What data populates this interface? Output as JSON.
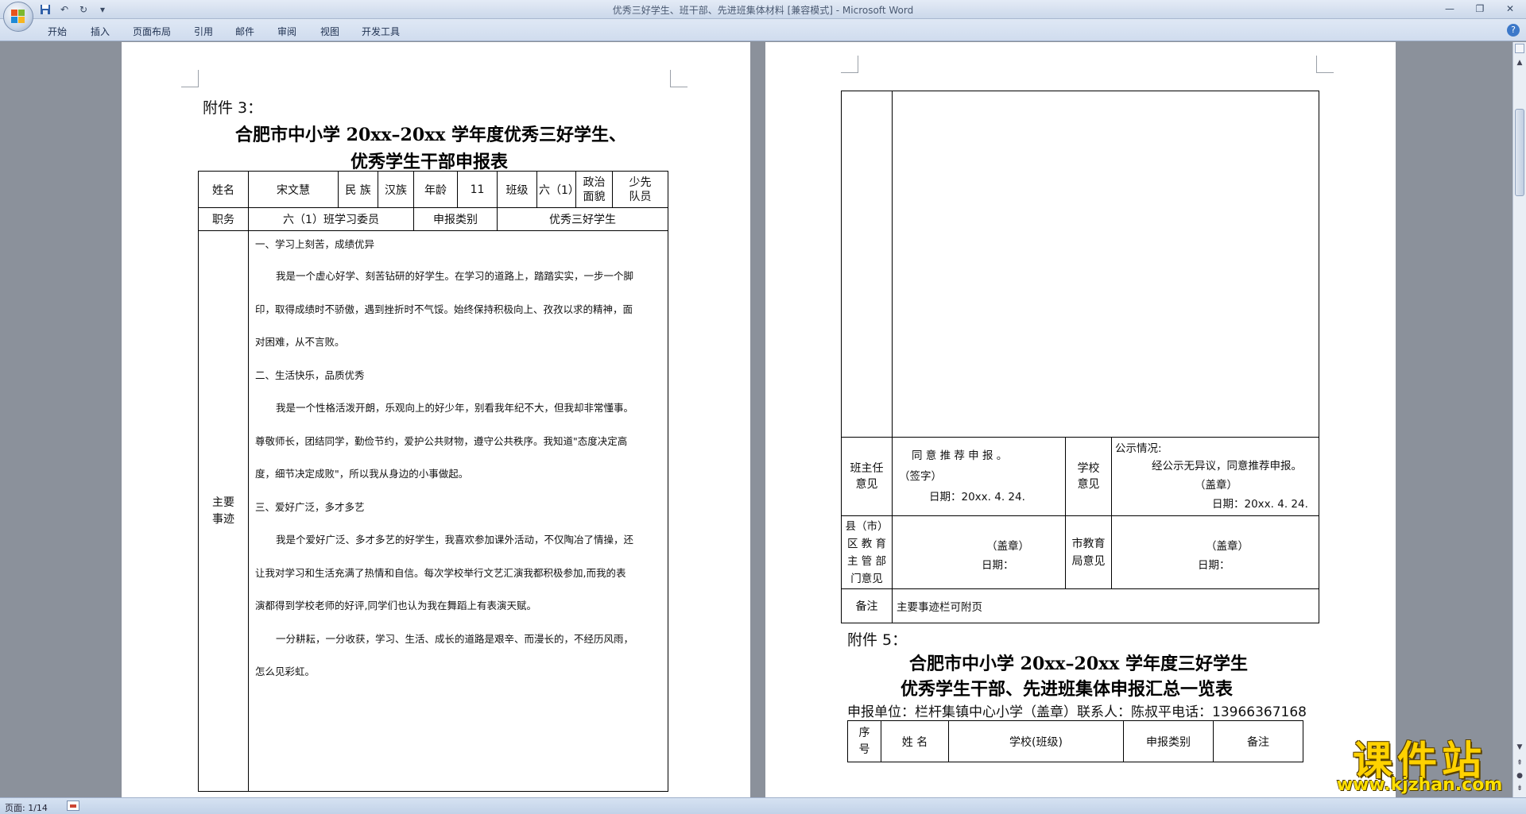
{
  "window": {
    "title": "优秀三好学生、班干部、先进班集体材料 [兼容模式] - Microsoft Word"
  },
  "ribbon": {
    "tabs": [
      "开始",
      "插入",
      "页面布局",
      "引用",
      "邮件",
      "审阅",
      "视图",
      "开发工具"
    ]
  },
  "page1": {
    "attachment_label": "附件 3：",
    "title_line1": "合肥市中小学 20xx–20xx 学年度优秀三好学生、",
    "title_line2": "优秀学生干部申报表",
    "form": {
      "name_label": "姓名",
      "name_value": "宋文慧",
      "ethnic_label": "民  族",
      "ethnic_value": "汉族",
      "age_label": "年龄",
      "age_value": "11",
      "class_label": "班级",
      "class_value": "六（1）",
      "political_label_1": "政治",
      "political_label_2": "面貌",
      "political_value_1": "少先",
      "political_value_2": "队员",
      "position_label": "职务",
      "position_value": "六（1）班学习委员",
      "category_label": "申报类别",
      "category_value": "优秀三好学生",
      "deeds_label_1": "主要",
      "deeds_label_2": "事迹",
      "deeds": [
        {
          "text": "一、学习上刻苦，成绩优异",
          "indent": false,
          "lead": true
        },
        {
          "text": "我是一个虚心好学、刻苦钻研的好学生。在学习的道路上，踏踏实实，一步一个脚",
          "indent": true
        },
        {
          "text": "印，取得成绩时不骄傲，遇到挫折时不气馁。始终保持积极向上、孜孜以求的精神，面",
          "indent": false
        },
        {
          "text": "对困难，从不言败。",
          "indent": false
        },
        {
          "text": "二、生活快乐，品质优秀",
          "indent": false
        },
        {
          "text": "我是一个性格活泼开朗，乐观向上的好少年，别看我年纪不大，但我却非常懂事。",
          "indent": true
        },
        {
          "text": "尊敬师长，团结同学，勤俭节约，爱护公共财物，遵守公共秩序。我知道\"态度决定高",
          "indent": false
        },
        {
          "text": "度，细节决定成败\"，所以我从身边的小事做起。",
          "indent": false
        },
        {
          "text": "三、爱好广泛，多才多艺",
          "indent": false
        },
        {
          "text": "我是个爱好广泛、多才多艺的好学生，我喜欢参加课外活动，不仅陶冶了情操，还",
          "indent": true
        },
        {
          "text": "让我对学习和生活充满了热情和自信。每次学校举行文艺汇演我都积极参加,而我的表",
          "indent": false
        },
        {
          "text": "演都得到学校老师的好评,同学们也认为我在舞蹈上有表演天赋。",
          "indent": false
        },
        {
          "text": "一分耕耘，一分收获，学习、生活、成长的道路是艰辛、而漫长的，不经历风雨，",
          "indent": true
        },
        {
          "text": "怎么见彩虹。",
          "indent": false
        },
        {
          "text": "",
          "indent": false
        },
        {
          "text": "",
          "indent": false
        },
        {
          "text": "",
          "indent": false
        }
      ]
    }
  },
  "page2": {
    "opinions": {
      "teacher_label_1": "班主任",
      "teacher_label_2": "意见",
      "teacher_text": "同 意 推 荐 申 报 。",
      "teacher_sign": "（签字）",
      "teacher_date": "日期：20xx. 4. 24.",
      "school_label_1": "学校",
      "school_label_2": "意见",
      "school_notice_title": "公示情况:",
      "school_notice_text": "经公示无异议，同意推荐申报。",
      "school_seal": "（盖章）",
      "school_date": "日期：20xx. 4. 24.",
      "county_label_1": "县（市）",
      "county_label_2": "区 教 育",
      "county_label_3": "主 管 部",
      "county_label_4": "门意见",
      "county_seal": "（盖章）",
      "county_date": "日期：",
      "city_label_1": "市教育",
      "city_label_2": "局意见",
      "city_seal": "（盖章）",
      "city_date": "日期：",
      "remark_label": "备注",
      "remark_value": "主要事迹栏可附页"
    },
    "attachment_label": "附件 5：",
    "title_line1": "合肥市中小学 20xx–20xx 学年度三好学生",
    "title_line2": "优秀学生干部、先进班集体申报汇总一览表",
    "applicant_line": "申报单位：栏杆集镇中心小学（盖章）联系人：陈叔平电话：13966367168",
    "summary_headers": {
      "index_1": "序",
      "index_2": "号",
      "name": "姓  名",
      "school_class": "学校(班级)",
      "category": "申报类别",
      "remark": "备注"
    }
  },
  "statusbar": {
    "page_count": "页面: 1/14"
  },
  "watermark": {
    "title": "课件站",
    "url": "www.kjzhan.com"
  }
}
